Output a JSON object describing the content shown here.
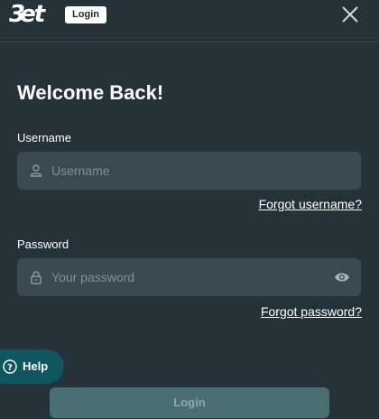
{
  "header": {
    "logo_text": "Bet",
    "badge_label": "Login"
  },
  "form": {
    "title": "Welcome Back!",
    "username": {
      "label": "Username",
      "placeholder": "Username",
      "value": ""
    },
    "forgot_username": "Forgot username?",
    "password": {
      "label": "Password",
      "placeholder": "Your password",
      "value": ""
    },
    "forgot_password": "Forgot password?",
    "submit_label": "Login"
  },
  "help": {
    "label": "Help"
  },
  "icons": [
    "close-icon",
    "user-icon",
    "lock-icon",
    "eye-icon",
    "question-circle-icon"
  ],
  "colors": {
    "background": "#26323a",
    "input_bg": "#3a4a52",
    "help_bg": "#0f5660",
    "login_btn_bg": "#4a6f72"
  }
}
